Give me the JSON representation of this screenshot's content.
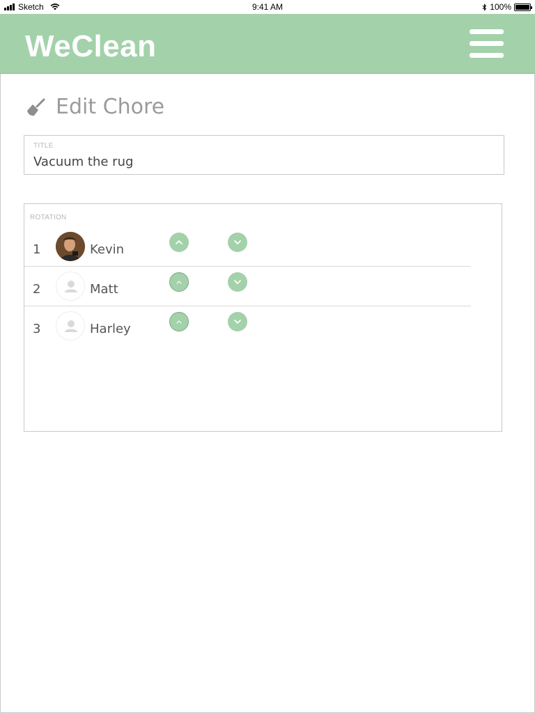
{
  "status_bar": {
    "carrier": "Sketch",
    "time": "9:41 AM",
    "battery_percent": "100%"
  },
  "header": {
    "app_title": "WeClean",
    "menu_icon": "hamburger-menu-icon",
    "background_color": "#a2d1aa"
  },
  "page": {
    "heading": "Edit Chore",
    "heading_icon": "broom-icon"
  },
  "title_field": {
    "label": "TITLE",
    "value": "Vacuum the rug"
  },
  "rotation": {
    "label": "ROTATION",
    "members": [
      {
        "number": "1",
        "name": "Kevin",
        "avatar": "photo"
      },
      {
        "number": "2",
        "name": "Matt",
        "avatar": "person-placeholder-icon"
      },
      {
        "number": "3",
        "name": "Harley",
        "avatar": "person-placeholder-icon"
      }
    ]
  },
  "colors": {
    "accent": "#a2d1aa",
    "muted_text": "#9b9b9b"
  }
}
